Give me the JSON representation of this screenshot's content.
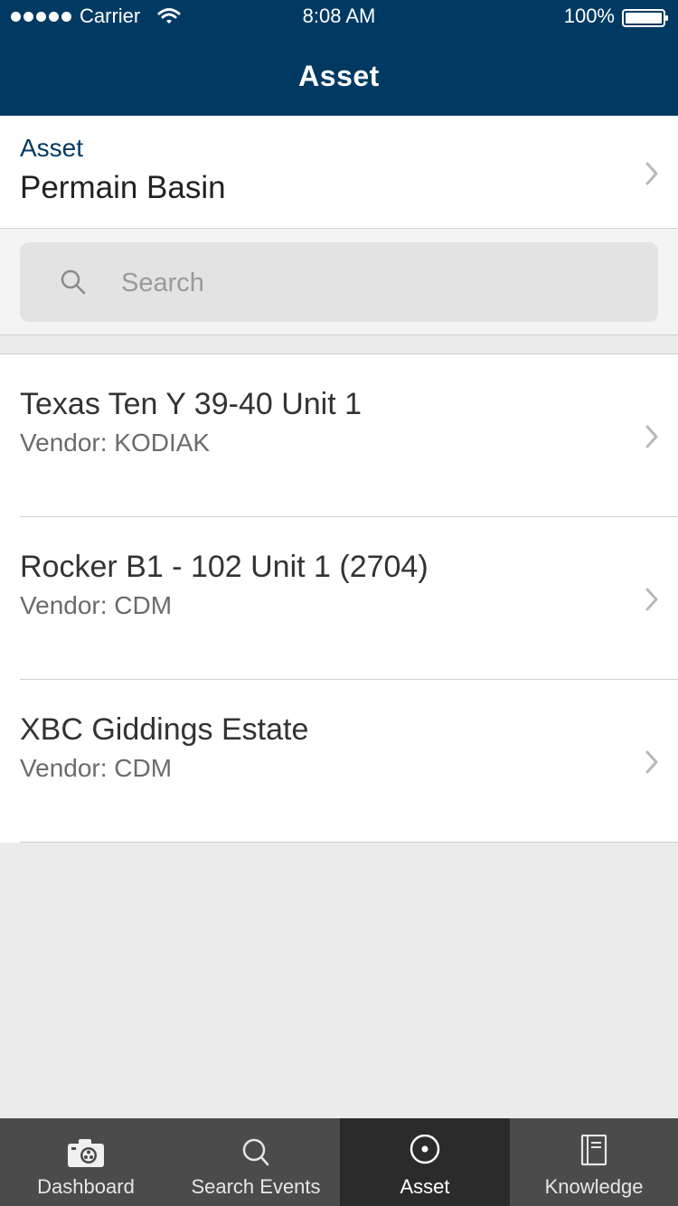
{
  "status_bar": {
    "carrier": "Carrier",
    "time": "8:08 AM",
    "battery": "100%"
  },
  "nav": {
    "title": "Asset"
  },
  "asset_selector": {
    "label": "Asset",
    "value": "Permain Basin"
  },
  "search": {
    "placeholder": "Search",
    "value": ""
  },
  "list": {
    "items": [
      {
        "title": "Texas Ten Y 39-40 Unit 1",
        "subtitle": "Vendor: KODIAK"
      },
      {
        "title": "Rocker B1 - 102 Unit 1 (2704)",
        "subtitle": "Vendor: CDM"
      },
      {
        "title": "XBC Giddings Estate",
        "subtitle": "Vendor: CDM"
      }
    ]
  },
  "tab_bar": {
    "tabs": [
      {
        "label": "Dashboard",
        "icon": "dashboard-camera-icon",
        "active": false
      },
      {
        "label": "Search Events",
        "icon": "search-icon",
        "active": false
      },
      {
        "label": "Asset",
        "icon": "target-icon",
        "active": true
      },
      {
        "label": "Knowledge",
        "icon": "notebook-icon",
        "active": false
      }
    ]
  },
  "colors": {
    "header_bg": "#003a63",
    "accent": "#003a63",
    "tab_bar_bg": "#4b4b4b",
    "tab_active_bg": "#2b2b2b"
  }
}
